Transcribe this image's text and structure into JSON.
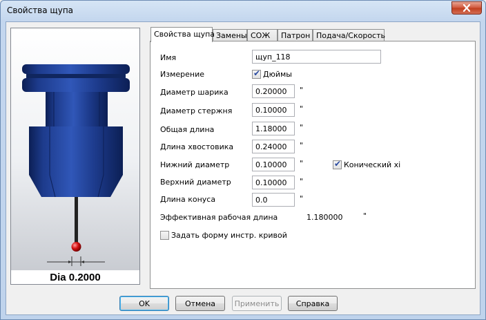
{
  "window": {
    "title": "Свойства щупа"
  },
  "preview": {
    "dia_label": "Dia 0.2000"
  },
  "tabs": [
    {
      "label": "Свойства щупа",
      "active": true
    },
    {
      "label": "Замены",
      "active": false
    },
    {
      "label": "СОЖ",
      "active": false
    },
    {
      "label": "Патрон",
      "active": false
    },
    {
      "label": "Подача/Скорость",
      "active": false
    }
  ],
  "form": {
    "name": {
      "label": "Имя",
      "value": "щуп_118"
    },
    "measurement": {
      "label": "Измерение",
      "checkbox_label": "Дюймы",
      "checked": true
    },
    "ball_diameter": {
      "label": "Диаметр шарика",
      "value": "0.20000",
      "unit": "\""
    },
    "stem_diameter": {
      "label": "Диаметр стержня",
      "value": "0.10000",
      "unit": "\""
    },
    "overall_length": {
      "label": "Общая длина",
      "value": "1.18000",
      "unit": "\""
    },
    "shank_length": {
      "label": "Длина хвостовика",
      "value": "0.24000",
      "unit": "\""
    },
    "lower_diameter": {
      "label": "Нижний диаметр",
      "value": "0.10000",
      "unit": "\""
    },
    "conical": {
      "label": "Конический хі",
      "checked": true
    },
    "upper_diameter": {
      "label": "Верхний диаметр",
      "value": "0.10000",
      "unit": "\""
    },
    "cone_length": {
      "label": "Длина конуса",
      "value": "0.0",
      "unit": "\""
    },
    "effective_length": {
      "label": "Эффективная рабочая длина",
      "value": "1.180000",
      "unit": "\""
    },
    "custom_shape": {
      "label": "Задать форму инстр. кривой",
      "checked": false
    }
  },
  "buttons": {
    "ok": "OK",
    "cancel": "Отмена",
    "apply": "Применить",
    "help": "Справка"
  }
}
